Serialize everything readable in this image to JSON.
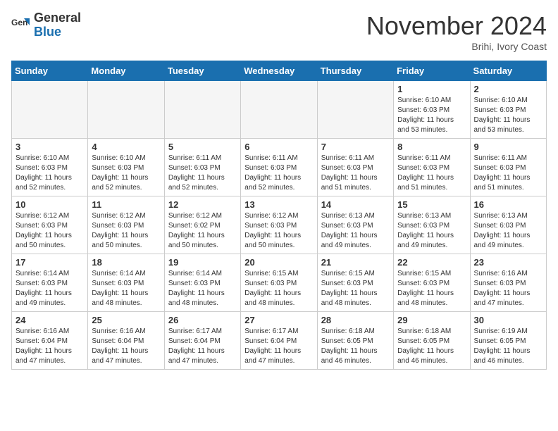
{
  "header": {
    "logo_line1": "General",
    "logo_line2": "Blue",
    "month_title": "November 2024",
    "location": "Brihi, Ivory Coast"
  },
  "weekdays": [
    "Sunday",
    "Monday",
    "Tuesday",
    "Wednesday",
    "Thursday",
    "Friday",
    "Saturday"
  ],
  "weeks": [
    [
      {
        "day": "",
        "empty": true
      },
      {
        "day": "",
        "empty": true
      },
      {
        "day": "",
        "empty": true
      },
      {
        "day": "",
        "empty": true
      },
      {
        "day": "",
        "empty": true
      },
      {
        "day": "1",
        "sunrise": "6:10 AM",
        "sunset": "6:03 PM",
        "daylight": "11 hours and 53 minutes."
      },
      {
        "day": "2",
        "sunrise": "6:10 AM",
        "sunset": "6:03 PM",
        "daylight": "11 hours and 53 minutes."
      }
    ],
    [
      {
        "day": "3",
        "sunrise": "6:10 AM",
        "sunset": "6:03 PM",
        "daylight": "11 hours and 52 minutes."
      },
      {
        "day": "4",
        "sunrise": "6:10 AM",
        "sunset": "6:03 PM",
        "daylight": "11 hours and 52 minutes."
      },
      {
        "day": "5",
        "sunrise": "6:11 AM",
        "sunset": "6:03 PM",
        "daylight": "11 hours and 52 minutes."
      },
      {
        "day": "6",
        "sunrise": "6:11 AM",
        "sunset": "6:03 PM",
        "daylight": "11 hours and 52 minutes."
      },
      {
        "day": "7",
        "sunrise": "6:11 AM",
        "sunset": "6:03 PM",
        "daylight": "11 hours and 51 minutes."
      },
      {
        "day": "8",
        "sunrise": "6:11 AM",
        "sunset": "6:03 PM",
        "daylight": "11 hours and 51 minutes."
      },
      {
        "day": "9",
        "sunrise": "6:11 AM",
        "sunset": "6:03 PM",
        "daylight": "11 hours and 51 minutes."
      }
    ],
    [
      {
        "day": "10",
        "sunrise": "6:12 AM",
        "sunset": "6:03 PM",
        "daylight": "11 hours and 50 minutes."
      },
      {
        "day": "11",
        "sunrise": "6:12 AM",
        "sunset": "6:03 PM",
        "daylight": "11 hours and 50 minutes."
      },
      {
        "day": "12",
        "sunrise": "6:12 AM",
        "sunset": "6:02 PM",
        "daylight": "11 hours and 50 minutes."
      },
      {
        "day": "13",
        "sunrise": "6:12 AM",
        "sunset": "6:03 PM",
        "daylight": "11 hours and 50 minutes."
      },
      {
        "day": "14",
        "sunrise": "6:13 AM",
        "sunset": "6:03 PM",
        "daylight": "11 hours and 49 minutes."
      },
      {
        "day": "15",
        "sunrise": "6:13 AM",
        "sunset": "6:03 PM",
        "daylight": "11 hours and 49 minutes."
      },
      {
        "day": "16",
        "sunrise": "6:13 AM",
        "sunset": "6:03 PM",
        "daylight": "11 hours and 49 minutes."
      }
    ],
    [
      {
        "day": "17",
        "sunrise": "6:14 AM",
        "sunset": "6:03 PM",
        "daylight": "11 hours and 49 minutes."
      },
      {
        "day": "18",
        "sunrise": "6:14 AM",
        "sunset": "6:03 PM",
        "daylight": "11 hours and 48 minutes."
      },
      {
        "day": "19",
        "sunrise": "6:14 AM",
        "sunset": "6:03 PM",
        "daylight": "11 hours and 48 minutes."
      },
      {
        "day": "20",
        "sunrise": "6:15 AM",
        "sunset": "6:03 PM",
        "daylight": "11 hours and 48 minutes."
      },
      {
        "day": "21",
        "sunrise": "6:15 AM",
        "sunset": "6:03 PM",
        "daylight": "11 hours and 48 minutes."
      },
      {
        "day": "22",
        "sunrise": "6:15 AM",
        "sunset": "6:03 PM",
        "daylight": "11 hours and 48 minutes."
      },
      {
        "day": "23",
        "sunrise": "6:16 AM",
        "sunset": "6:03 PM",
        "daylight": "11 hours and 47 minutes."
      }
    ],
    [
      {
        "day": "24",
        "sunrise": "6:16 AM",
        "sunset": "6:04 PM",
        "daylight": "11 hours and 47 minutes."
      },
      {
        "day": "25",
        "sunrise": "6:16 AM",
        "sunset": "6:04 PM",
        "daylight": "11 hours and 47 minutes."
      },
      {
        "day": "26",
        "sunrise": "6:17 AM",
        "sunset": "6:04 PM",
        "daylight": "11 hours and 47 minutes."
      },
      {
        "day": "27",
        "sunrise": "6:17 AM",
        "sunset": "6:04 PM",
        "daylight": "11 hours and 47 minutes."
      },
      {
        "day": "28",
        "sunrise": "6:18 AM",
        "sunset": "6:05 PM",
        "daylight": "11 hours and 46 minutes."
      },
      {
        "day": "29",
        "sunrise": "6:18 AM",
        "sunset": "6:05 PM",
        "daylight": "11 hours and 46 minutes."
      },
      {
        "day": "30",
        "sunrise": "6:19 AM",
        "sunset": "6:05 PM",
        "daylight": "11 hours and 46 minutes."
      }
    ]
  ]
}
